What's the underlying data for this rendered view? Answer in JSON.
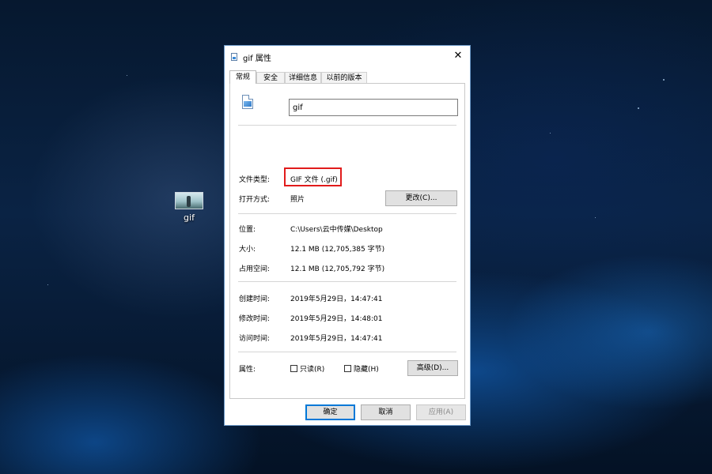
{
  "desktop": {
    "icon_label": "gif"
  },
  "dialog": {
    "title": "gif 属性",
    "close_glyph": "✕",
    "tabs": [
      {
        "label": "常规"
      },
      {
        "label": "安全"
      },
      {
        "label": "详细信息"
      },
      {
        "label": "以前的版本"
      }
    ],
    "filename": "gif",
    "file_type_label": "文件类型:",
    "file_type_value": "GIF 文件 (.gif)",
    "opens_with_label": "打开方式:",
    "opens_with_value": "照片",
    "change_button": "更改(C)...",
    "location_label": "位置:",
    "location_value": "C:\\Users\\云中传媒\\Desktop",
    "size_label": "大小:",
    "size_value": "12.1 MB (12,705,385 字节)",
    "size_on_disk_label": "占用空间:",
    "size_on_disk_value": "12.1 MB (12,705,792 字节)",
    "created_label": "创建时间:",
    "created_value": "2019年5月29日，14:47:41",
    "modified_label": "修改时间:",
    "modified_value": "2019年5月29日，14:48:01",
    "accessed_label": "访问时间:",
    "accessed_value": "2019年5月29日，14:47:41",
    "attributes_label": "属性:",
    "readonly_label": "只读(R)",
    "hidden_label": "隐藏(H)",
    "advanced_button": "高级(D)...",
    "ok_button": "确定",
    "cancel_button": "取消",
    "apply_button": "应用(A)"
  },
  "colors": {
    "highlight_box": "#e11b1b",
    "primary_button_border": "#0078d7",
    "dialog_border": "#6b98c7"
  }
}
